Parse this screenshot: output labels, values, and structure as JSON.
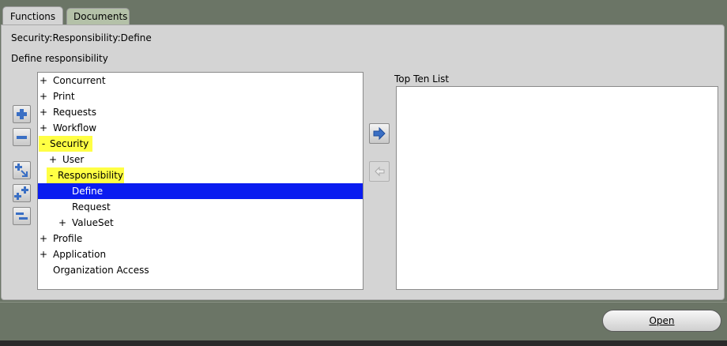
{
  "tabs": [
    {
      "label": "Functions",
      "active": true
    },
    {
      "label": "Documents",
      "active": false
    }
  ],
  "breadcrumb": "Security:Responsibility:Define",
  "section_title": "Define responsibility",
  "tree": {
    "selected": "Define",
    "highlighted": [
      "Security",
      "Responsibility"
    ],
    "rows": [
      {
        "expander": "+",
        "label": "Concurrent",
        "level": 0
      },
      {
        "expander": "+",
        "label": "Print",
        "level": 0
      },
      {
        "expander": "+",
        "label": "Requests",
        "level": 0
      },
      {
        "expander": "+",
        "label": "Workflow",
        "level": 0
      },
      {
        "expander": "-",
        "label": "Security",
        "level": 0
      },
      {
        "expander": "+",
        "label": "User",
        "level": 1
      },
      {
        "expander": "-",
        "label": "Responsibility",
        "level": 1
      },
      {
        "expander": "",
        "label": "Define",
        "level": 2
      },
      {
        "expander": "",
        "label": "Request",
        "level": 2
      },
      {
        "expander": "+",
        "label": "ValueSet",
        "level": 2
      },
      {
        "expander": "+",
        "label": "Profile",
        "level": 0
      },
      {
        "expander": "+",
        "label": "Application",
        "level": 0
      },
      {
        "expander": "",
        "label": "Organization Access",
        "level": 0
      }
    ]
  },
  "top_ten": {
    "label": "Top Ten List",
    "items": []
  },
  "buttons": {
    "open": "Open"
  },
  "icons": {
    "expand": "plus-icon",
    "collapse": "minus-icon",
    "expand_branch": "expand-branch-icon",
    "expand_all": "expand-all-icon",
    "collapse_all": "collapse-all-icon",
    "add_to_list": "arrow-right-icon",
    "remove_from_list": "arrow-left-icon"
  },
  "colors": {
    "background": "#6b7566",
    "panel": "#d4d4d4",
    "inactive_tab": "#b4c1a8",
    "selection": "#0a1cf0",
    "highlight": "#ffff44",
    "icon_blue": "#3a6fc4"
  }
}
